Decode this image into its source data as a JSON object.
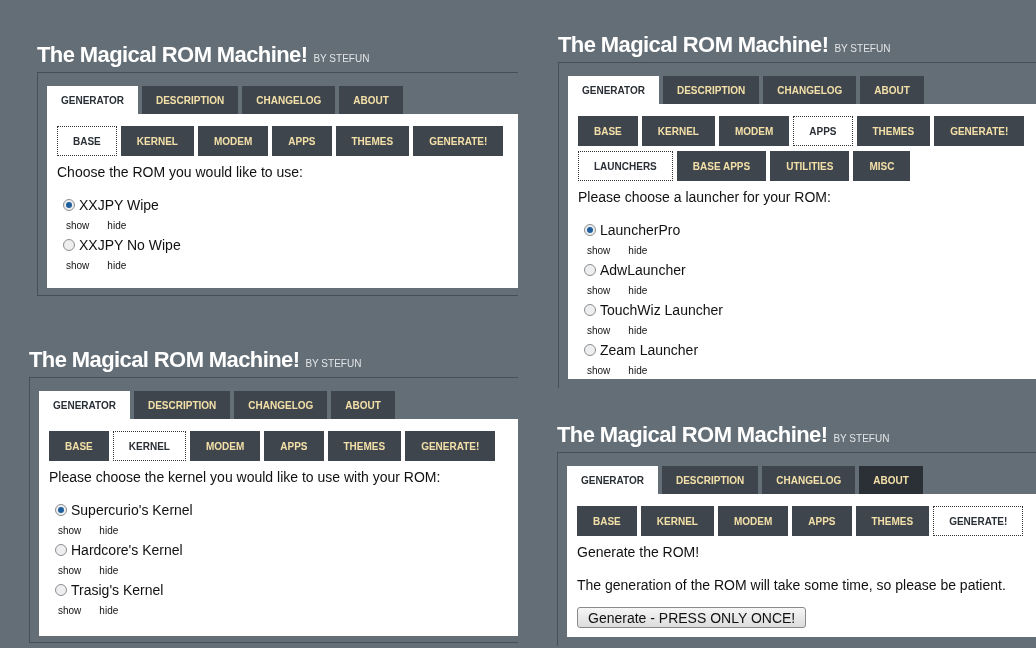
{
  "panels": [
    {
      "title": "The Magical ROM Machine!",
      "byline": "BY STEFUN",
      "main_tabs": [
        {
          "label": "GENERATOR",
          "selected": true,
          "highlighted": false
        },
        {
          "label": "DESCRIPTION",
          "selected": false,
          "highlighted": false
        },
        {
          "label": "CHANGELOG",
          "selected": false,
          "highlighted": false
        },
        {
          "label": "ABOUT",
          "selected": false,
          "highlighted": false
        }
      ],
      "sub_tabs": [
        {
          "label": "BASE",
          "selected": true
        },
        {
          "label": "KERNEL",
          "selected": false
        },
        {
          "label": "MODEM",
          "selected": false
        },
        {
          "label": "APPS",
          "selected": false
        },
        {
          "label": "THEMES",
          "selected": false
        },
        {
          "label": "GENERATE!",
          "selected": false
        }
      ],
      "prompt": "Choose the ROM you would like to use:",
      "options": [
        {
          "label": "XXJPY Wipe",
          "selected": true,
          "show": "show",
          "hide": "hide"
        },
        {
          "label": "XXJPY No Wipe",
          "selected": false,
          "show": "show",
          "hide": "hide"
        }
      ]
    },
    {
      "title": "The Magical ROM Machine!",
      "byline": "BY STEFUN",
      "main_tabs": [
        {
          "label": "GENERATOR",
          "selected": true,
          "highlighted": false
        },
        {
          "label": "DESCRIPTION",
          "selected": false,
          "highlighted": false
        },
        {
          "label": "CHANGELOG",
          "selected": false,
          "highlighted": false
        },
        {
          "label": "ABOUT",
          "selected": false,
          "highlighted": false
        }
      ],
      "sub_tabs": [
        {
          "label": "BASE",
          "selected": false
        },
        {
          "label": "KERNEL",
          "selected": false
        },
        {
          "label": "MODEM",
          "selected": false
        },
        {
          "label": "APPS",
          "selected": true
        },
        {
          "label": "THEMES",
          "selected": false
        },
        {
          "label": "GENERATE!",
          "selected": false
        }
      ],
      "category_tabs": [
        {
          "label": "LAUNCHERS",
          "selected": true
        },
        {
          "label": "BASE APPS",
          "selected": false
        },
        {
          "label": "UTILITIES",
          "selected": false
        },
        {
          "label": "MISC",
          "selected": false
        }
      ],
      "prompt": "Please choose a launcher for your ROM:",
      "options": [
        {
          "label": "LauncherPro",
          "selected": true,
          "show": "show",
          "hide": "hide"
        },
        {
          "label": "AdwLauncher",
          "selected": false,
          "show": "show",
          "hide": "hide"
        },
        {
          "label": "TouchWiz Launcher",
          "selected": false,
          "show": "show",
          "hide": "hide"
        },
        {
          "label": "Zeam Launcher",
          "selected": false,
          "show": "show",
          "hide": "hide"
        }
      ]
    },
    {
      "title": "The Magical ROM Machine!",
      "byline": "BY STEFUN",
      "main_tabs": [
        {
          "label": "GENERATOR",
          "selected": true,
          "highlighted": false
        },
        {
          "label": "DESCRIPTION",
          "selected": false,
          "highlighted": false
        },
        {
          "label": "CHANGELOG",
          "selected": false,
          "highlighted": false
        },
        {
          "label": "ABOUT",
          "selected": false,
          "highlighted": false
        }
      ],
      "sub_tabs": [
        {
          "label": "BASE",
          "selected": false
        },
        {
          "label": "KERNEL",
          "selected": true
        },
        {
          "label": "MODEM",
          "selected": false
        },
        {
          "label": "APPS",
          "selected": false
        },
        {
          "label": "THEMES",
          "selected": false
        },
        {
          "label": "GENERATE!",
          "selected": false
        }
      ],
      "prompt": "Please choose the kernel you would like to use with your ROM:",
      "options": [
        {
          "label": "Supercurio's Kernel",
          "selected": true,
          "show": "show",
          "hide": "hide"
        },
        {
          "label": "Hardcore's Kernel",
          "selected": false,
          "show": "show",
          "hide": "hide"
        },
        {
          "label": "Trasig's Kernel",
          "selected": false,
          "show": "show",
          "hide": "hide"
        }
      ]
    },
    {
      "title": "The Magical ROM Machine!",
      "byline": "BY STEFUN",
      "main_tabs": [
        {
          "label": "GENERATOR",
          "selected": true,
          "highlighted": false
        },
        {
          "label": "DESCRIPTION",
          "selected": false,
          "highlighted": false
        },
        {
          "label": "CHANGELOG",
          "selected": false,
          "highlighted": false
        },
        {
          "label": "ABOUT",
          "selected": false,
          "highlighted": true
        }
      ],
      "sub_tabs": [
        {
          "label": "BASE",
          "selected": false
        },
        {
          "label": "KERNEL",
          "selected": false
        },
        {
          "label": "MODEM",
          "selected": false
        },
        {
          "label": "APPS",
          "selected": false
        },
        {
          "label": "THEMES",
          "selected": false
        },
        {
          "label": "GENERATE!",
          "selected": true
        }
      ],
      "prompt": "Generate the ROM!",
      "note": "The generation of the ROM will take some time, so please be patient.",
      "button": "Generate - PRESS ONLY ONCE!"
    }
  ]
}
